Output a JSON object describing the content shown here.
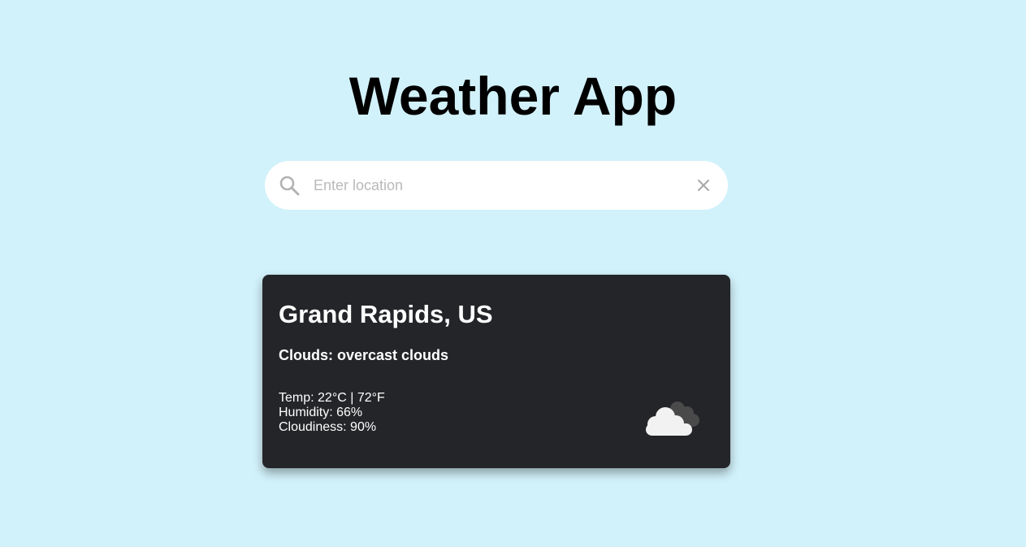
{
  "header": {
    "title": "Weather App"
  },
  "search": {
    "placeholder": "Enter location",
    "value": "",
    "search_icon": "search-icon",
    "clear_icon": "close-icon"
  },
  "weather": {
    "location": "Grand Rapids, US",
    "description": "Clouds: overcast clouds",
    "temperature": "Temp: 22°C | 72°F",
    "humidity": "Humidity: 66%",
    "cloudiness": "Cloudiness: 90%",
    "icon": "overcast-clouds-icon"
  },
  "colors": {
    "background": "#d2f2fb",
    "card": "#232528",
    "text_on_card": "#ffffff",
    "placeholder": "#b9b9b9"
  }
}
